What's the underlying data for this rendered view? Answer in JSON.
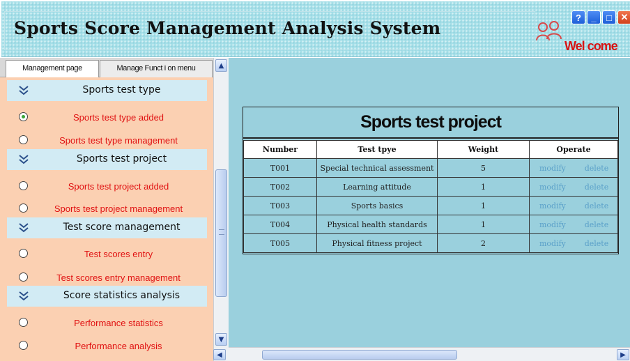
{
  "header": {
    "title": "Sports Score Management Analysis System",
    "welcome": "Wel come",
    "window_buttons": {
      "help": "?",
      "minimize": "_",
      "maximize": "□",
      "close": "✕"
    }
  },
  "sidebar": {
    "tabs": [
      {
        "label": "Management page",
        "active": true
      },
      {
        "label": "Manage Funct i on menu",
        "active": false
      }
    ],
    "sections": [
      {
        "title": "Sports test type",
        "items": [
          {
            "label": "Sports test type added",
            "selected": true
          },
          {
            "label": "Sports test type management",
            "selected": false
          }
        ]
      },
      {
        "title": "Sports test project",
        "items": [
          {
            "label": "Sports test project added",
            "selected": false
          },
          {
            "label": "Sports test project management",
            "selected": false
          }
        ]
      },
      {
        "title": "Test score management",
        "items": [
          {
            "label": "Test scores entry",
            "selected": false
          },
          {
            "label": "Test scores entry management",
            "selected": false
          }
        ]
      },
      {
        "title": "Score statistics analysis",
        "items": [
          {
            "label": "Performance statistics",
            "selected": false
          },
          {
            "label": "Performance analysis",
            "selected": false
          }
        ]
      }
    ]
  },
  "main": {
    "table_title": "Sports test project",
    "columns": [
      "Number",
      "Test tpye",
      "Weight",
      "Operate"
    ],
    "rows": [
      {
        "number": "T001",
        "test_type": "Special technical assessment",
        "weight": "5",
        "modify": "modify",
        "delete": "delete"
      },
      {
        "number": "T002",
        "test_type": "Learning attitude",
        "weight": "1",
        "modify": "modify",
        "delete": "delete"
      },
      {
        "number": "T003",
        "test_type": "Sports basics",
        "weight": "1",
        "modify": "modify",
        "delete": "delete"
      },
      {
        "number": "T004",
        "test_type": "Physical health standards",
        "weight": "1",
        "modify": "modify",
        "delete": "delete"
      },
      {
        "number": "T005",
        "test_type": "Physical fitness project",
        "weight": "2",
        "modify": "modify",
        "delete": "delete"
      }
    ]
  },
  "colors": {
    "header_bg": "#a5dfe8",
    "sidebar_bg": "#fbd0b2",
    "section_header_bg": "#d2ebf4",
    "main_bg": "#9ad0dd",
    "menu_text": "#e01212",
    "welcome_text": "#d81414",
    "link_text": "#5aa0c9"
  },
  "icons": {
    "users": "users-icon",
    "section": "double-chevron-down-icon",
    "radio": "radio-icon"
  }
}
